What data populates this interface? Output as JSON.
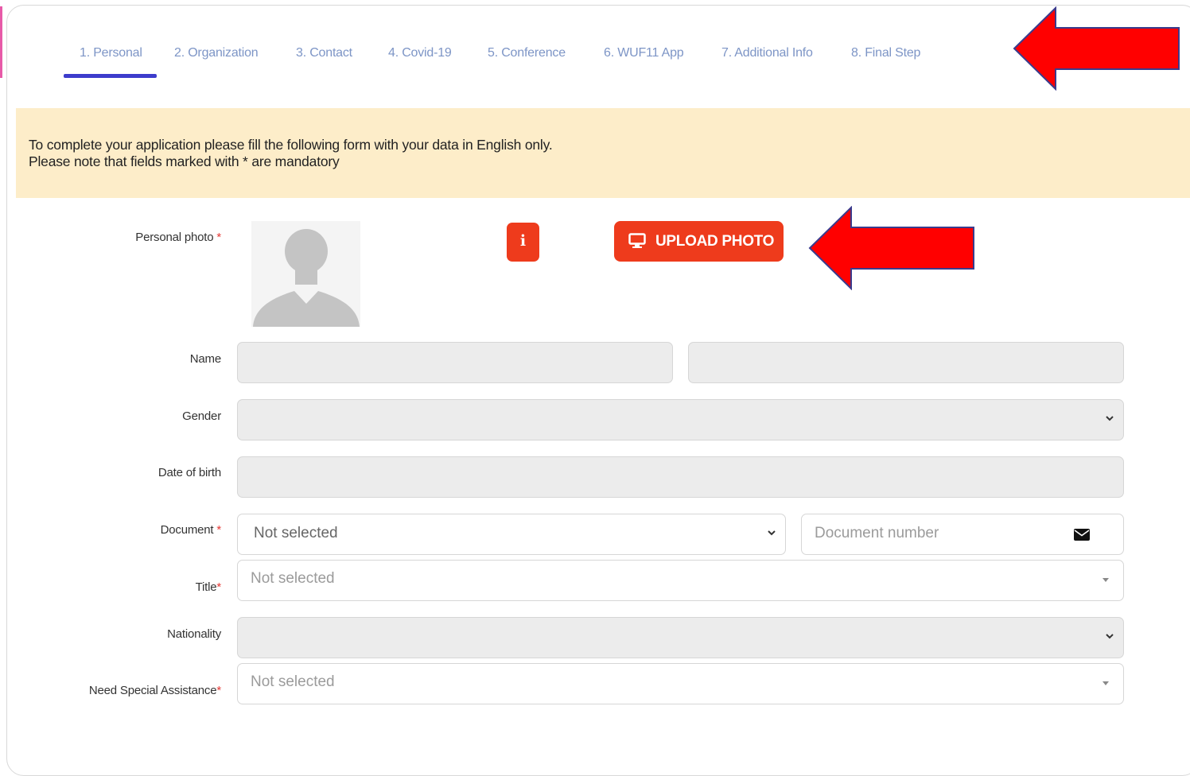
{
  "tabs": [
    {
      "label": "1. Personal",
      "active": true
    },
    {
      "label": "2. Organization",
      "active": false
    },
    {
      "label": "3. Contact",
      "active": false
    },
    {
      "label": "4. Covid-19",
      "active": false
    },
    {
      "label": "5. Conference",
      "active": false
    },
    {
      "label": "6. WUF11 App",
      "active": false
    },
    {
      "label": "7. Additional Info",
      "active": false
    },
    {
      "label": "8. Final Step",
      "active": false
    }
  ],
  "notice": {
    "line1": "To complete your application please fill the following form with your data in English only.",
    "line2": "Please note that fields marked with * are mandatory"
  },
  "form": {
    "photo": {
      "label": "Personal photo",
      "required_mark": "*",
      "upload_label": "UPLOAD PHOTO",
      "info_icon": "info-icon",
      "upload_icon": "monitor-icon"
    },
    "name": {
      "label": "Name",
      "first_value": "",
      "last_value": ""
    },
    "gender": {
      "label": "Gender",
      "value": ""
    },
    "dob": {
      "label": "Date of birth",
      "value": ""
    },
    "document": {
      "label": "Document",
      "required_mark": "*",
      "value": "Not selected",
      "number_placeholder": "Document number",
      "number_icon": "envelope-icon"
    },
    "title": {
      "label": "Title",
      "required_mark": "*",
      "value": "Not selected"
    },
    "nationality": {
      "label": "Nationality",
      "value": ""
    },
    "special_assistance": {
      "label": "Need Special Assistance",
      "required_mark": "*",
      "value": "Not selected"
    }
  },
  "colors": {
    "accent": "#3d3ccc",
    "tab_text": "#7d95c6",
    "notice_bg": "#fdedc9",
    "button": "#ee3b1c",
    "annotation_arrow": "#ff0000",
    "required": "#e53935"
  }
}
